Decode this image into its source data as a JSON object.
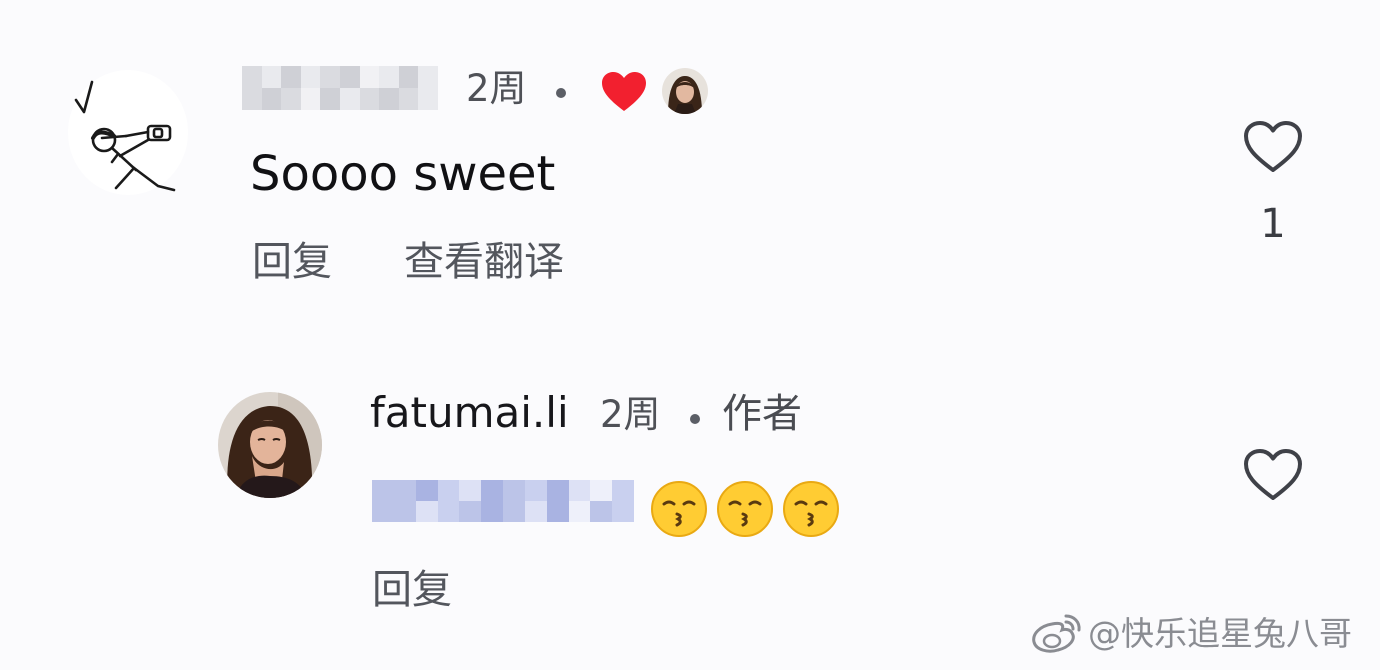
{
  "comments": [
    {
      "username_visible": false,
      "time": "2周",
      "text": "Soooo sweet",
      "actions": {
        "reply": "回复",
        "translate": "查看翻译"
      },
      "likes": "1",
      "icons": {
        "author_liked": "heart-icon",
        "like": "heart-outline-icon"
      },
      "colors": {
        "liked_heart": "#f2202f"
      }
    }
  ],
  "reply": {
    "username": "fatumai.li",
    "time": "2周",
    "author_badge": "作者",
    "text_visible": false,
    "emojis": [
      "😙",
      "😙",
      "😙"
    ],
    "actions": {
      "reply": "回复"
    },
    "icons": {
      "like": "heart-outline-icon"
    }
  },
  "watermark": {
    "icon": "weibo-icon",
    "text": "@快乐追星兔八哥"
  }
}
